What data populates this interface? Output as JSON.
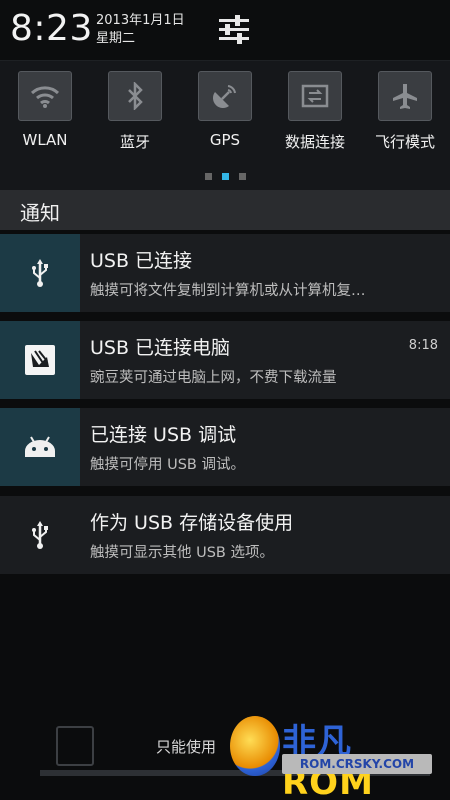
{
  "header": {
    "time": "8:23",
    "date": "2013年1月1日",
    "weekday": "星期二",
    "settings_icon": "sliders-icon"
  },
  "toggles": [
    {
      "label": "WLAN",
      "icon": "wifi-icon"
    },
    {
      "label": "蓝牙",
      "icon": "bluetooth-icon"
    },
    {
      "label": "GPS",
      "icon": "gps-icon"
    },
    {
      "label": "数据连接",
      "icon": "data-connection-icon"
    },
    {
      "label": "飞行模式",
      "icon": "airplane-icon"
    }
  ],
  "pager": {
    "count": 3,
    "active_index": 1
  },
  "section": {
    "title": "通知"
  },
  "notifications": [
    {
      "title": "USB 已连接",
      "desc": "触摸可将文件复制到计算机或从计算机复…",
      "time": "",
      "icon": "usb-icon"
    },
    {
      "title": "USB 已连接电脑",
      "desc": "豌豆荚可通过电脑上网，不费下载流量",
      "time": "8:18",
      "icon": "wandoujia-icon"
    },
    {
      "title": "已连接 USB 调试",
      "desc": "触摸可停用 USB 调试。",
      "time": "",
      "icon": "android-icon"
    },
    {
      "title": "作为 USB 存储设备使用",
      "desc": "触摸可显示其他 USB 选项。",
      "time": "",
      "icon": "usb-icon"
    }
  ],
  "bottom": {
    "text": "只能使用"
  },
  "watermark": {
    "main_a": "非凡",
    "main_b": "ROM",
    "sub": "ROM.CRSKY.COM"
  },
  "colors": {
    "accent": "#33b5e5",
    "icon_teal": "#1c3a45"
  }
}
